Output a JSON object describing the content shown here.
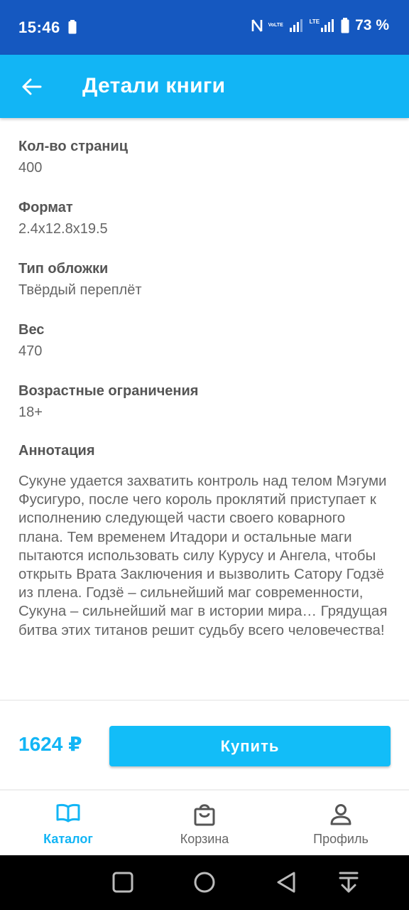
{
  "status_bar": {
    "time": "15:46",
    "battery_percent": "73 %",
    "lte_label": "LTE",
    "volte_label": "VoLTE"
  },
  "app_bar": {
    "title": "Детали книги",
    "back_icon": "arrow-left-icon"
  },
  "details": [
    {
      "label": "Кол-во страниц",
      "value": "400"
    },
    {
      "label": "Формат",
      "value": "2.4x12.8x19.5"
    },
    {
      "label": "Тип обложки",
      "value": "Твёрдый переплёт"
    },
    {
      "label": "Вес",
      "value": "470"
    },
    {
      "label": "Возрастные ограничения",
      "value": "18+"
    }
  ],
  "annotation": {
    "title": "Аннотация",
    "text": "Сукуне удается захватить контроль над телом Мэгуми Фусигуро, после чего король проклятий приступает к исполнению следующей части своего коварного плана. Тем временем Итадори и остальные маги пытаются использовать силу Курусу и Ангела, чтобы открыть Врата Заключения и вызволить Сатору Годзё из плена. Годзё – сильнейший маг современности, Сукуна – сильнейший маг в истории мира… Грядущая битва этих титанов решит судьбу всего человечества!"
  },
  "purchase": {
    "price": "1624 ₽",
    "buy_label": "Купить"
  },
  "bottom_nav": {
    "items": [
      {
        "label": "Каталог",
        "icon": "book-icon",
        "active": true
      },
      {
        "label": "Корзина",
        "icon": "shopping-bag-icon",
        "active": false
      },
      {
        "label": "Профиль",
        "icon": "person-icon",
        "active": false
      }
    ]
  },
  "colors": {
    "status_bar": "#1558c0",
    "accent": "#12b5f5",
    "text_label": "#555555",
    "text_value": "#666666"
  }
}
